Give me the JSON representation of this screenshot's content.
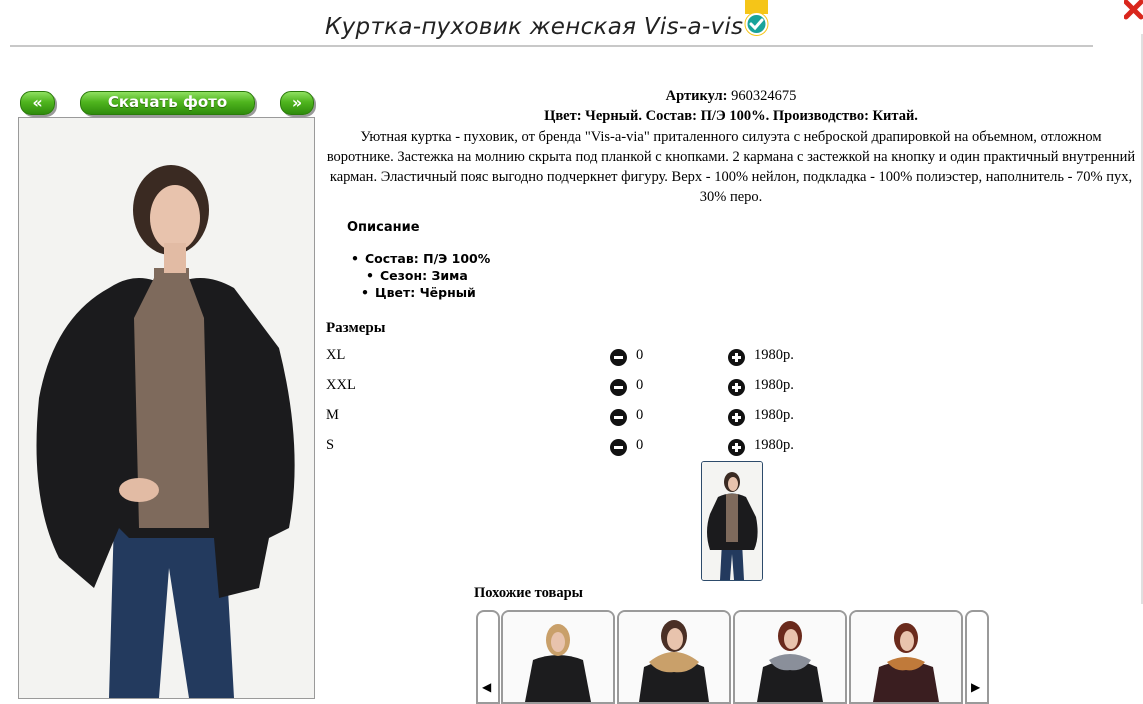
{
  "product": {
    "title": "Куртка-пуховик женская Vis-a-vis",
    "article_label": "Артикул:",
    "article_value": "960324675",
    "meta_line": "Цвет: Черный. Состав: П/Э 100%. Производство: Китай.",
    "description": "Уютная куртка - пуховик, от бренда \"Vis-a-via\" приталенного силуэта с неброской драпировкой на объемном, отложном воротнике. Застежка на молнию скрыта под планкой с кнопками. 2 кармана с застежкой на кнопку и один практичный внутренний карман. Эластичный пояс выгодно подчеркнет фигуру. Верх - 100% нейлон, подкладка - 100% полиэстер, наполнитель - 70% пух, 30% перо."
  },
  "gallery": {
    "prev_label": "«",
    "download_label": "Скачать фото",
    "next_label": "»"
  },
  "specs": {
    "heading": "Описание",
    "items": [
      "Состав: П/Э 100%",
      "Сезон: Зима",
      "Цвет: Чёрный"
    ]
  },
  "sizes": {
    "heading": "Размеры",
    "rows": [
      {
        "name": "XL",
        "qty": "0",
        "price": "1980р."
      },
      {
        "name": "XXL",
        "qty": "0",
        "price": "1980р."
      },
      {
        "name": "M",
        "qty": "0",
        "price": "1980р."
      },
      {
        "name": "S",
        "qty": "0",
        "price": "1980р."
      }
    ]
  },
  "similar": {
    "heading": "Похожие товары",
    "left_arrow": "◀",
    "right_arrow": "▶"
  },
  "colors": {
    "button_green": "#4fb51e",
    "verified_teal": "#19a39a",
    "badge_yellow": "#f5c518",
    "close_red": "#d9261c"
  }
}
